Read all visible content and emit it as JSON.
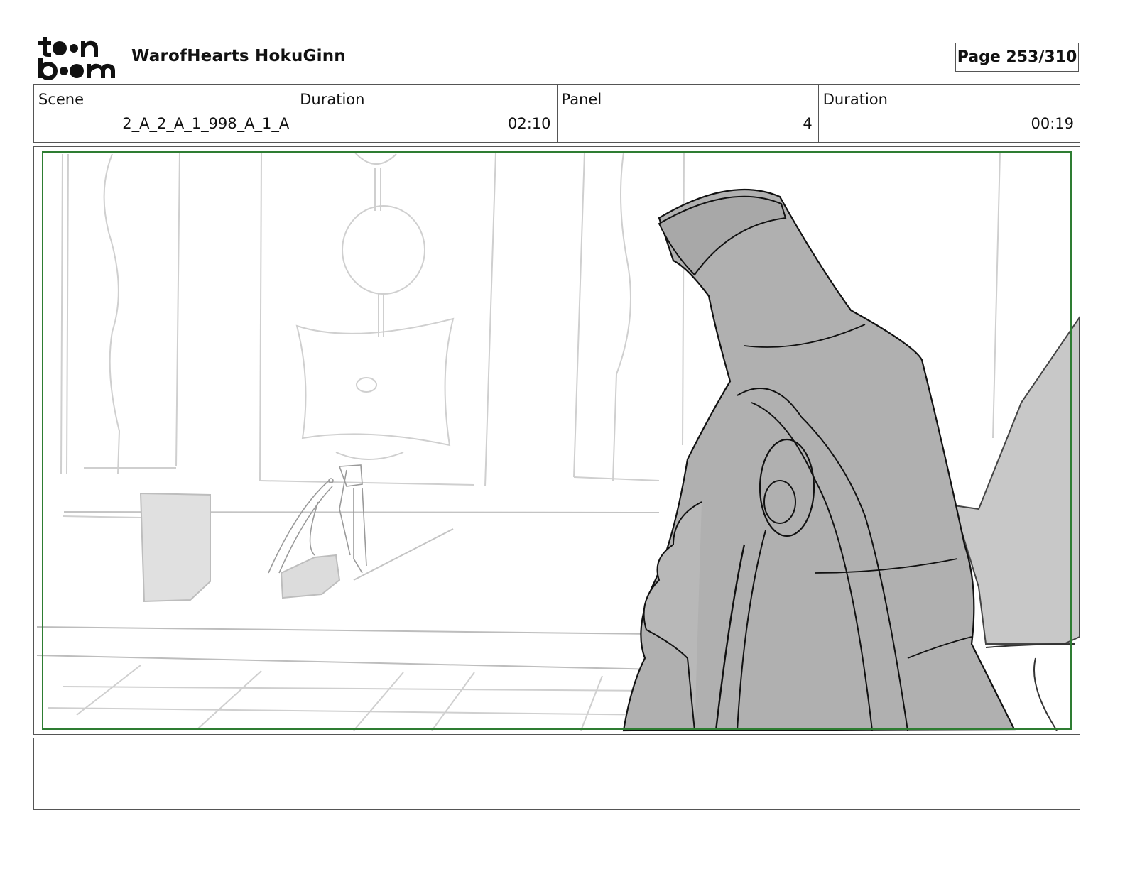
{
  "header": {
    "logo_alt": "toon boom",
    "project_title": "WarofHearts HokuGinn",
    "page": "Page 253/310"
  },
  "info": {
    "scene_label": "Scene",
    "scene_value": "2_A_2_A_1_998_A_1_A",
    "scene_duration_label": "Duration",
    "scene_duration_value": "02:10",
    "panel_label": "Panel",
    "panel_value": "4",
    "panel_duration_label": "Duration",
    "panel_duration_value": "00:19"
  },
  "colors": {
    "safe_frame": "#2e7d32",
    "sketch_light": "#cfcfcf",
    "fill_gray": "#b0b0b0"
  }
}
